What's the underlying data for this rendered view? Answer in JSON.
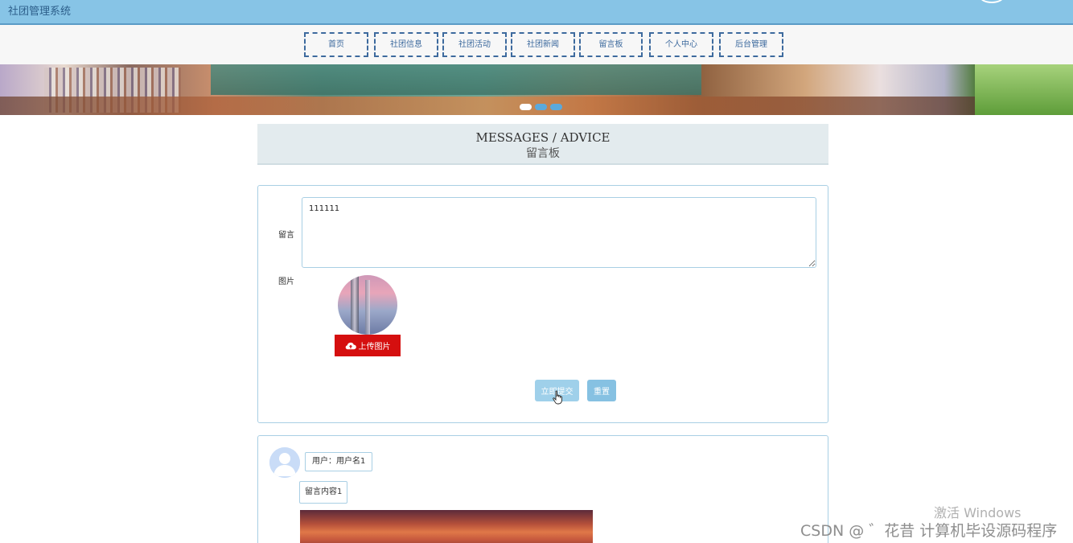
{
  "header": {
    "title": "社团管理系统"
  },
  "nav": {
    "items": [
      {
        "label": "首页"
      },
      {
        "label": "社团信息"
      },
      {
        "label": "社团活动"
      },
      {
        "label": "社团新闻"
      },
      {
        "label": "留言板"
      },
      {
        "label": "个人中心"
      },
      {
        "label": "后台管理"
      }
    ]
  },
  "banner": {
    "slides": 3,
    "active_slide": 2
  },
  "section": {
    "title_en": "MESSAGES / ADVICE",
    "title_cn": "留言板"
  },
  "form": {
    "message_label": "留言",
    "message_value": "111111",
    "image_label": "图片",
    "upload_label": "上传图片",
    "submit_label": "立即提交",
    "reset_label": "重置"
  },
  "messages": [
    {
      "user": "用户：用户名1",
      "content": "留言内容1"
    }
  ],
  "watermarks": {
    "activate": "激活 Windows",
    "csdn": "CSDN @ ゛花昔  计算机毕设源码程序"
  },
  "colors": {
    "header_bg": "#87c4e6",
    "nav_border": "#3d6a9e",
    "upload_bg": "#d50f0f",
    "submit_bg": "#9fd0ea",
    "card_border": "#a9cfe4"
  }
}
